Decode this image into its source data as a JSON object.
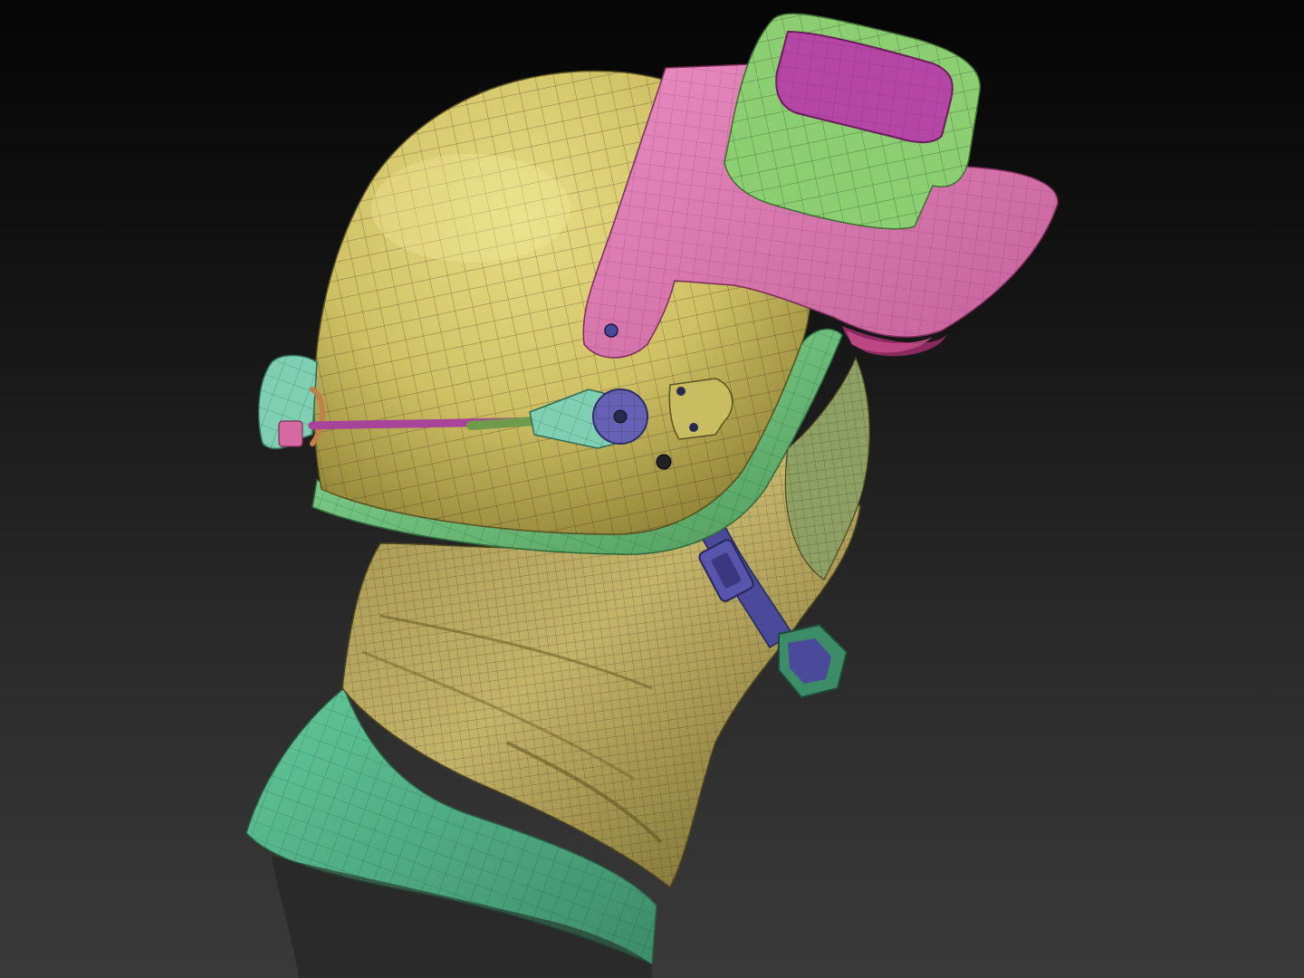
{
  "scene": {
    "subject": "sculpted-helmet-bust-with-polygroups",
    "colors": {
      "background_top": "#050505",
      "background_bottom": "#3a3a3a",
      "helmet_shell": "#d4c76a",
      "helmet_rim": "#7fd48a",
      "visor_pink": "#e27ab4",
      "visor_magenta": "#b546a6",
      "visor_mount_green": "#8ccf72",
      "balaclava": "#b8a65e",
      "collar_teal": "#5fc38f",
      "strap_purple": "#4b4a9a",
      "wire_magenta": "#a8459a",
      "bracket_teal": "#7fcfb2",
      "pivot_blue": "#6561b5"
    },
    "icons": [
      "helmet-icon",
      "visor-icon",
      "strap-icon",
      "cable-icon"
    ]
  }
}
